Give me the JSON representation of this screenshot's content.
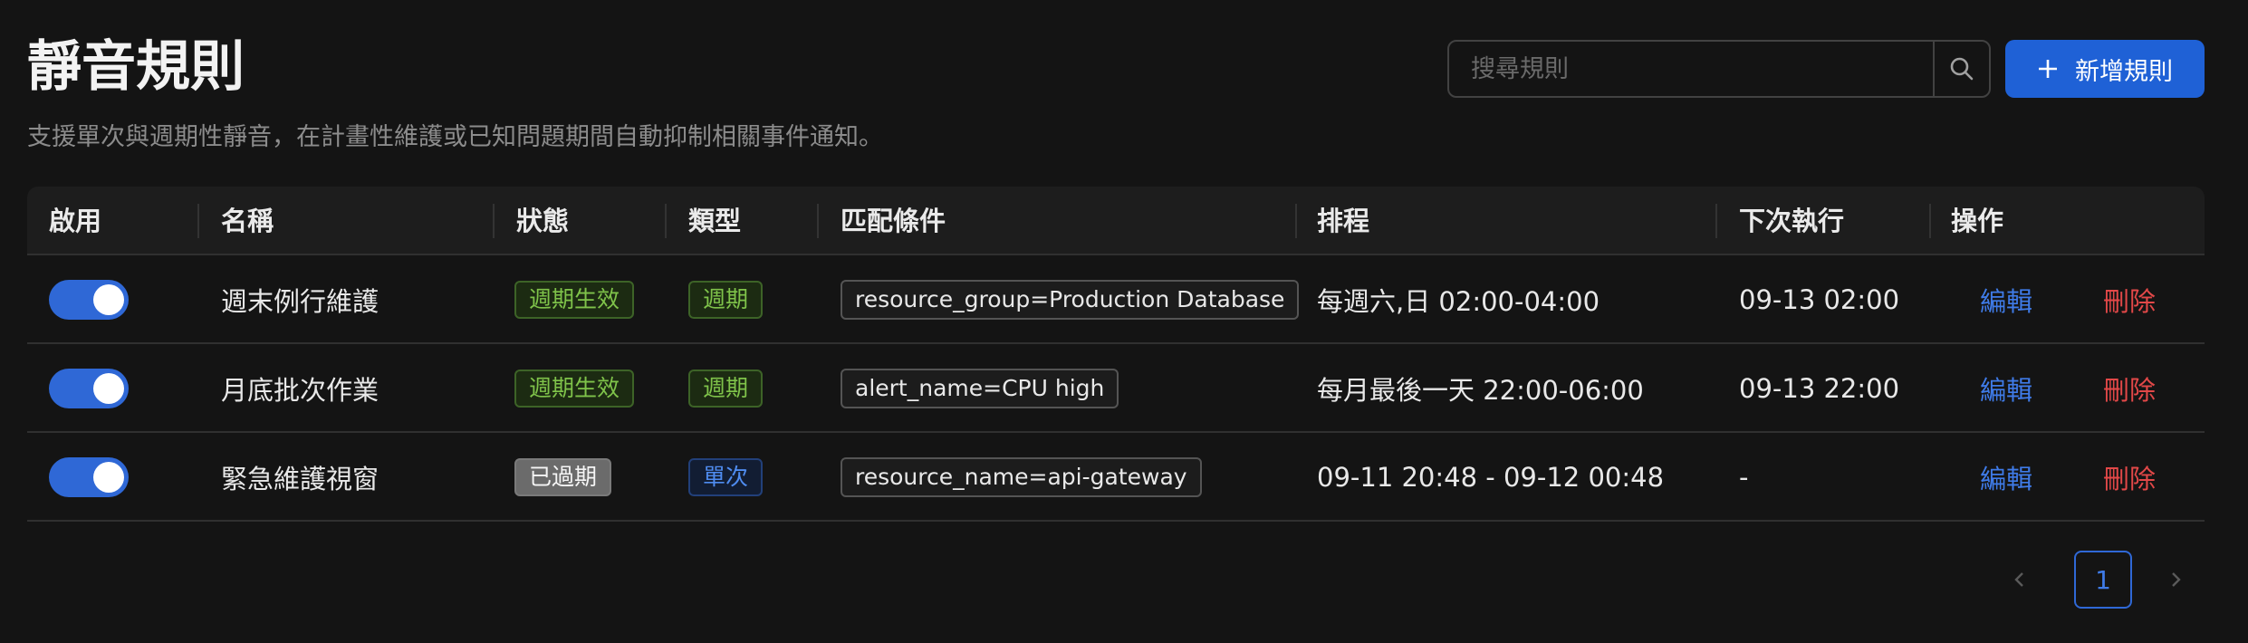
{
  "header": {
    "title": "靜音規則",
    "subtitle": "支援單次與週期性靜音，在計畫性維護或已知問題期間自動抑制相關事件通知。"
  },
  "search": {
    "placeholder": "搜尋規則",
    "value": "",
    "icon": "search-icon"
  },
  "add_button": {
    "label": "新增規則",
    "icon": "plus-icon"
  },
  "table": {
    "columns": [
      "啟用",
      "名稱",
      "狀態",
      "類型",
      "匹配條件",
      "排程",
      "下次執行",
      "操作"
    ],
    "rows": [
      {
        "enabled": true,
        "name": "週末例行維護",
        "status": "週期生效",
        "type": "週期",
        "condition": "resource_group=Production Database",
        "schedule": "每週六,日 02:00-04:00",
        "next_run": "09-13 02:00",
        "edit": "編輯",
        "delete": "刪除"
      },
      {
        "enabled": true,
        "name": "月底批次作業",
        "status": "週期生效",
        "type": "週期",
        "condition": "alert_name=CPU high",
        "schedule": "每月最後一天 22:00-06:00",
        "next_run": "09-13 22:00",
        "edit": "編輯",
        "delete": "刪除"
      },
      {
        "enabled": true,
        "name": "緊急維護視窗",
        "status": "已過期",
        "type": "單次",
        "condition": "resource_name=api-gateway",
        "schedule": "09-11 20:48 - 09-12 00:48",
        "next_run": "-",
        "edit": "編輯",
        "delete": "刪除"
      }
    ]
  },
  "pagination": {
    "current_page": "1",
    "prev_icon": "chevron-left-icon",
    "next_icon": "chevron-right-icon"
  },
  "colors": {
    "accent": "#1f61d6",
    "background": "#141414",
    "status_active": "#7fc34a",
    "status_expired": "#6b6b6b",
    "type_once": "#4f8cf0",
    "delete": "#e24848"
  }
}
